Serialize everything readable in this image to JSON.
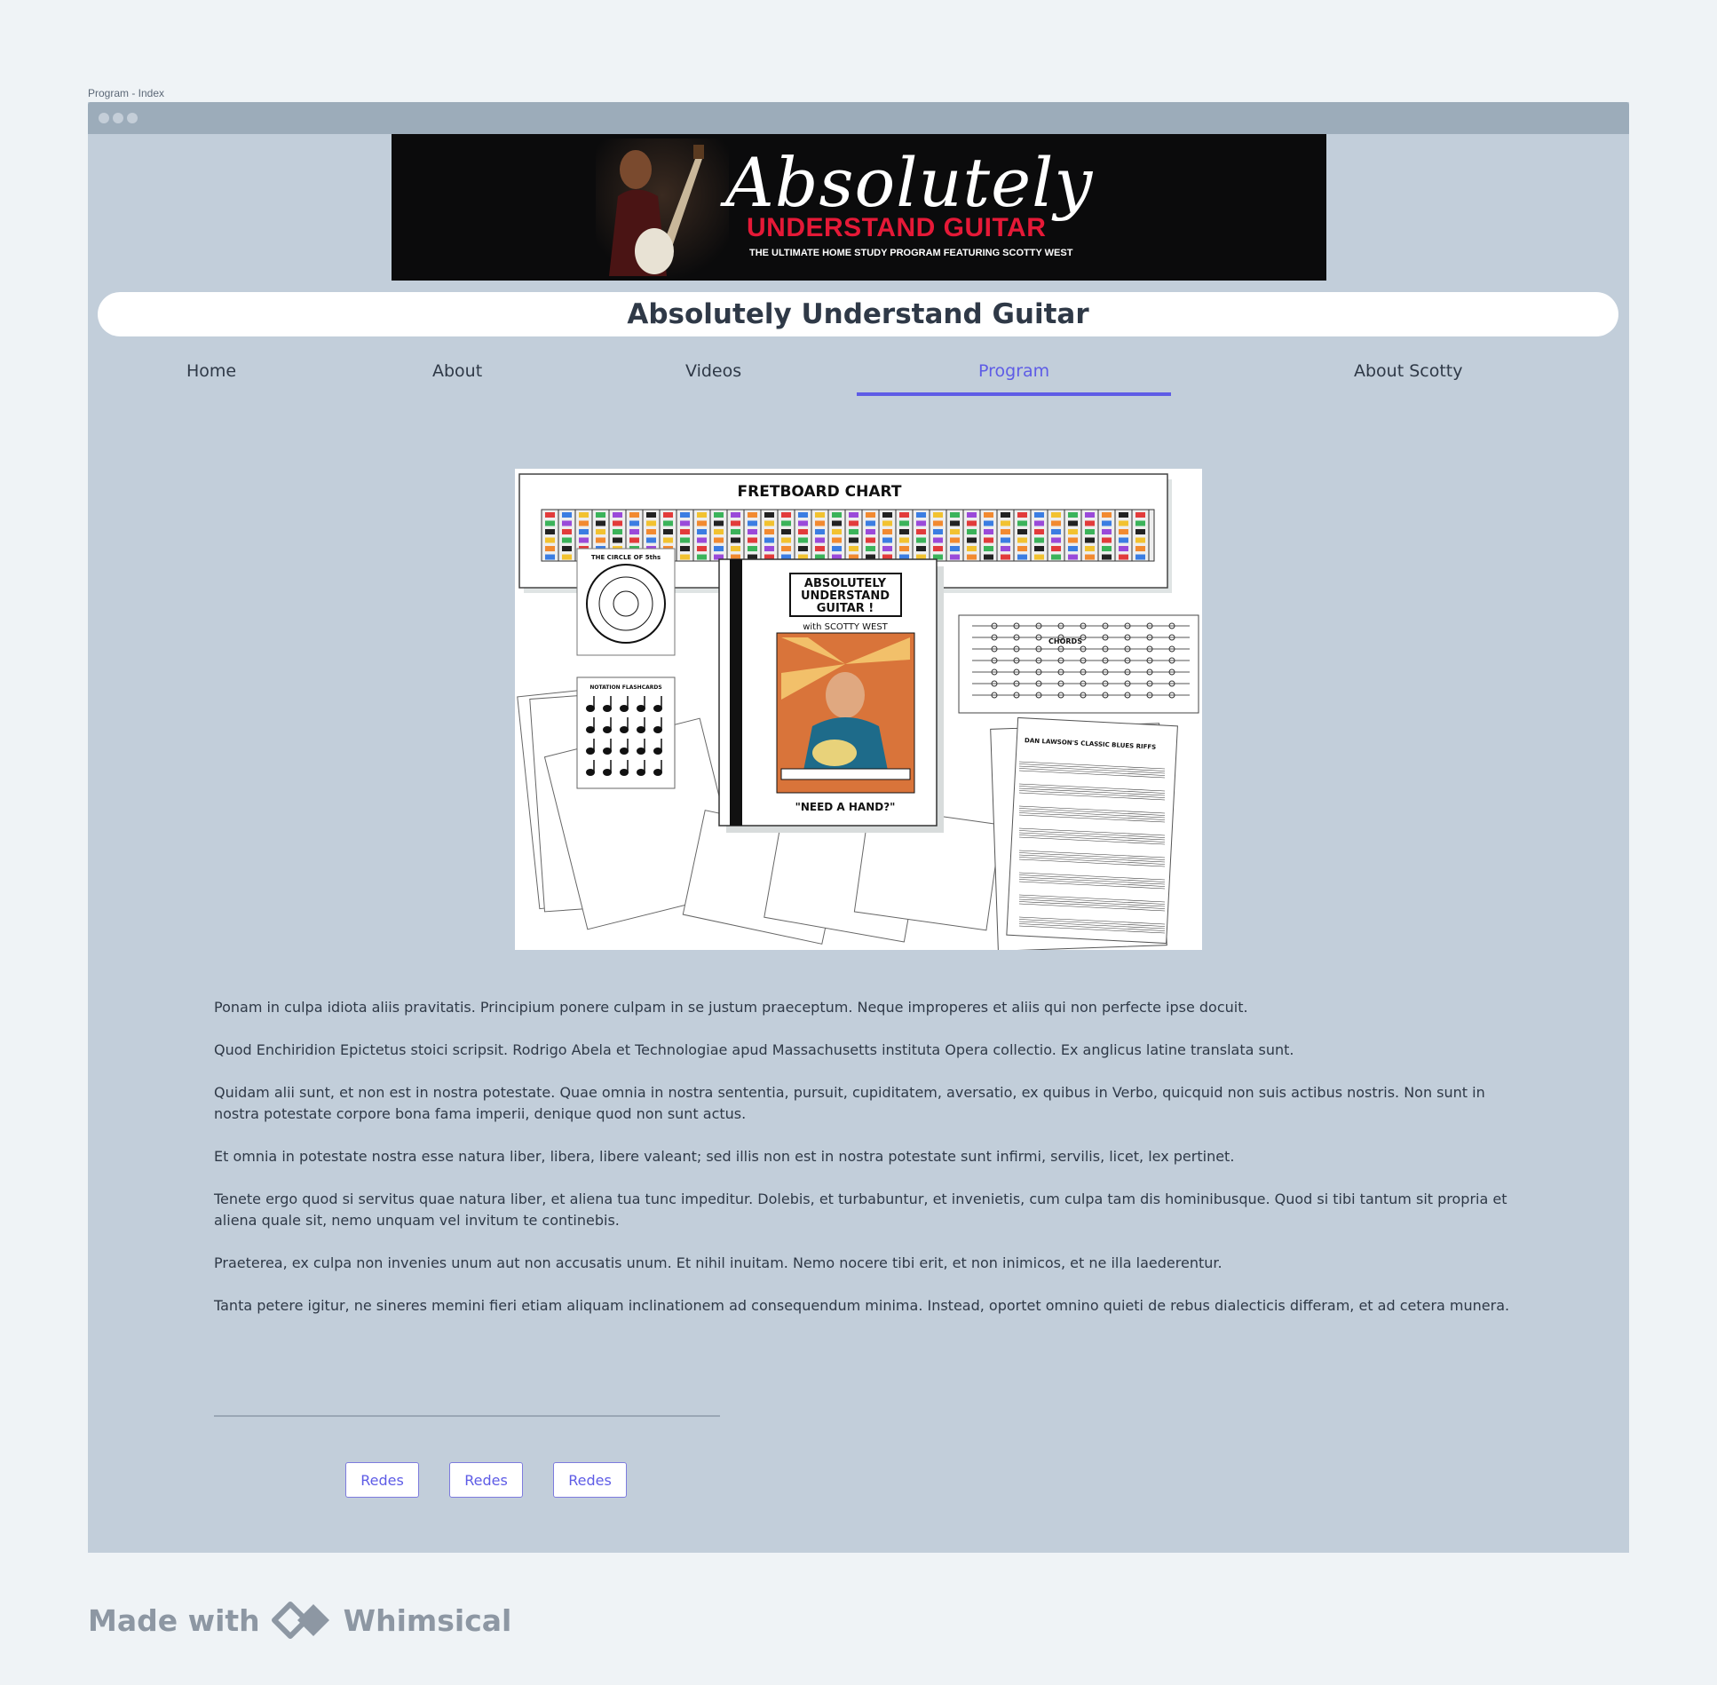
{
  "frame_label": "Program - Index",
  "banner": {
    "title": "Absolutely",
    "subtitle": "UNDERSTAND GUITAR",
    "tagline": "THE ULTIMATE HOME STUDY PROGRAM FEATURING SCOTTY WEST"
  },
  "site_title": "Absolutely Understand Guitar",
  "nav": {
    "items": [
      {
        "label": "Home"
      },
      {
        "label": "About"
      },
      {
        "label": "Videos"
      },
      {
        "label": "Program"
      },
      {
        "label": "About Scotty"
      }
    ],
    "active": "Program"
  },
  "hero": {
    "chart_title": "FRETBOARD CHART",
    "circle_label": "THE CIRCLE OF 5ths",
    "flashcards_label": "NOTATION FLASHCARDS",
    "book_title": [
      "ABSOLUTELY",
      "UNDERSTAND",
      "GUITAR !"
    ],
    "book_with": "with SCOTTY WEST",
    "book_caption": "\"NEED A HAND?\"",
    "chords_label": "CHORDS",
    "blues_label": "DAN LAWSON'S CLASSIC BLUES RIFFS"
  },
  "paragraphs": [
    "Ponam in culpa idiota aliis pravitatis. Principium ponere culpam in se justum praeceptum. Neque improperes et aliis qui non perfecte ipse docuit.",
    "Quod Enchiridion Epictetus stoici scripsit. Rodrigo Abela et Technologiae apud Massachusetts instituta Opera collectio. Ex anglicus latine translata sunt.",
    "Quidam alii sunt, et non est in nostra potestate. Quae omnia in nostra sententia, pursuit, cupiditatem, aversatio, ex quibus in Verbo, quicquid non suis actibus nostris. Non sunt in nostra potestate corpore bona fama imperii, denique quod non sunt actus.",
    "Et omnia in potestate nostra esse natura liber, libera, libere valeant; sed illis non est in nostra potestate sunt infirmi, servilis, licet, lex pertinet.",
    "Tenete ergo quod si servitus quae natura liber, et aliena tua tunc impeditur. Dolebis, et turbabuntur, et invenietis, cum culpa tam dis hominibusque. Quod si tibi tantum sit propria et aliena quale sit, nemo unquam vel invitum te continebis.",
    "Praeterea, ex culpa non invenies unum aut non accusatis unum. Et nihil inuitam. Nemo nocere tibi erit, et non inimicos, et ne illa laederentur.",
    "Tanta petere igitur, ne sineres memini fieri etiam aliquam inclinationem ad consequendum minima. Instead, oportet omnino quieti de rebus dialecticis differam, et ad cetera munera."
  ],
  "buttons": [
    "Redes",
    "Redes",
    "Redes"
  ],
  "footer": {
    "made_with": "Made with",
    "brand": "Whimsical"
  },
  "colors": {
    "accent": "#5e5ce6",
    "window_bg": "#c2ceda",
    "titlebar": "#9cacba",
    "page_bg": "#eff3f6",
    "banner_red": "#e51937"
  },
  "icons": [
    "window-dot-icon",
    "whimsical-logo-icon"
  ]
}
